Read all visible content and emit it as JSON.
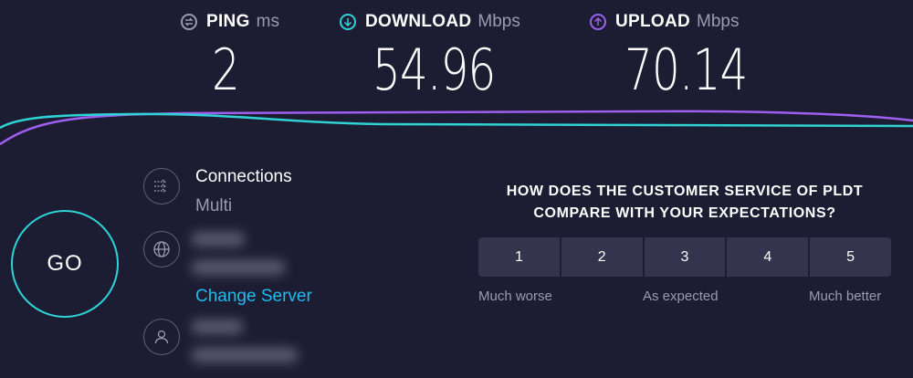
{
  "metrics": {
    "ping": {
      "label": "PING",
      "unit": "ms",
      "value": "2",
      "icon": "ping-icon"
    },
    "download": {
      "label": "DOWNLOAD",
      "unit": "Mbps",
      "value": "54.96",
      "icon": "download-arrow-icon"
    },
    "upload": {
      "label": "UPLOAD",
      "unit": "Mbps",
      "value": "70.14",
      "icon": "upload-arrow-icon"
    }
  },
  "colors": {
    "background": "#1c1c32",
    "download": "#2fd3d6",
    "upload": "#9f5ff0",
    "link": "#1fbcef",
    "muted": "#9a9ab3"
  },
  "go_label": "GO",
  "connections": {
    "title": "Connections",
    "value": "Multi",
    "icon": "connections-arrows-icon"
  },
  "server": {
    "icon": "globe-icon",
    "change_label": "Change Server"
  },
  "provider": {
    "icon": "user-icon"
  },
  "survey": {
    "question_line1": "HOW DOES THE CUSTOMER SERVICE OF PLDT",
    "question_line2": "COMPARE WITH YOUR EXPECTATIONS?",
    "options": [
      "1",
      "2",
      "3",
      "4",
      "5"
    ],
    "low_label": "Much worse",
    "mid_label": "As expected",
    "high_label": "Much better"
  }
}
